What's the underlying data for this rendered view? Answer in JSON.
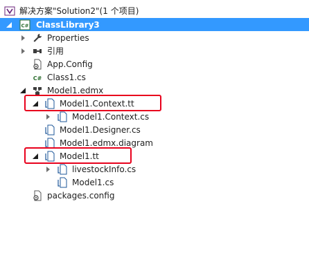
{
  "solution": {
    "label": "解决方案\"Solution2\"(1 个项目)"
  },
  "project": {
    "label": "ClassLibrary3"
  },
  "items": {
    "properties": "Properties",
    "references": "引用",
    "app_config": "App.Config",
    "class1": "Class1.cs",
    "model_edmx": "Model1.edmx",
    "context_tt": "Model1.Context.tt",
    "context_cs": "Model1.Context.cs",
    "designer_cs": "Model1.Designer.cs",
    "edmx_diagram": "Model1.edmx.diagram",
    "model_tt": "Model1.tt",
    "livestock_cs": "livestockInfo.cs",
    "model_cs": "Model1.cs",
    "packages_config": "packages.config"
  },
  "colors": {
    "selection": "#3399ff",
    "highlight": "#e8001c"
  }
}
